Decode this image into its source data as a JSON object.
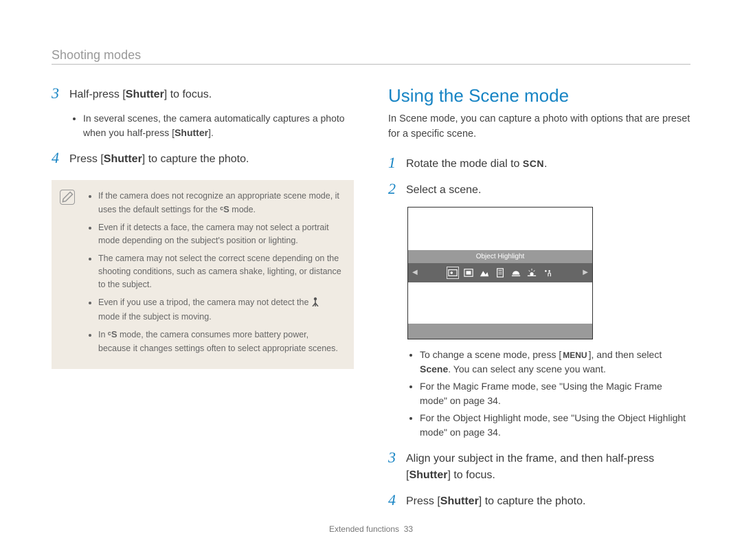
{
  "header": {
    "title": "Shooting modes"
  },
  "left": {
    "step3": {
      "num": "3",
      "text_before": "Half-press [",
      "shutter": "Shutter",
      "text_after": "] to focus.",
      "bullet_before": "In several scenes, the camera automatically captures a photo when you half-press [",
      "bullet_shutter": "Shutter",
      "bullet_after": "]."
    },
    "step4": {
      "num": "4",
      "text_before": "Press [",
      "shutter": "Shutter",
      "text_after": "] to capture the photo."
    },
    "note": {
      "b1_before": "If the camera does not recognize an appropriate scene mode, it uses the default settings for the ",
      "b1_glyph": "ᶜS",
      "b1_after": " mode.",
      "b2": "Even if it detects a face, the camera may not select a portrait mode depending on the subject's position or lighting.",
      "b3": "The camera may not select the correct scene depending on the shooting conditions, such as camera shake, lighting, or distance to the subject.",
      "b4_before": "Even if you use a tripod, the camera may not detect the ",
      "b4_after": " mode if the subject is moving.",
      "b5_before": "In ",
      "b5_glyph": "ᶜS",
      "b5_after": " mode, the camera consumes more battery power, because it changes settings often to select appropriate scenes."
    }
  },
  "right": {
    "title": "Using the Scene mode",
    "intro": "In Scene mode, you can capture a photo with options that are preset for a specific scene.",
    "step1": {
      "num": "1",
      "text_before": "Rotate the mode dial to ",
      "scn": "SCN",
      "text_after": "."
    },
    "step2": {
      "num": "2",
      "text": "Select a scene."
    },
    "lcd_label": "Object Highlight",
    "tips": {
      "t1_a": "To change a scene mode, press [",
      "t1_menu": "MENU",
      "t1_b": "], and then select ",
      "t1_scene": "Scene",
      "t1_c": ". You can select any scene you want.",
      "t2": "For the Magic Frame mode, see \"Using the Magic Frame mode\" on page 34.",
      "t3": "For the Object Highlight mode, see \"Using the Object Highlight mode\" on page 34."
    },
    "step3": {
      "num": "3",
      "a": "Align your subject in the frame, and then half-press [",
      "shutter": "Shutter",
      "b": "] to focus."
    },
    "step4": {
      "num": "4",
      "a": "Press [",
      "shutter": "Shutter",
      "b": "] to capture the photo."
    }
  },
  "footer": {
    "label": "Extended functions",
    "page": "33"
  }
}
